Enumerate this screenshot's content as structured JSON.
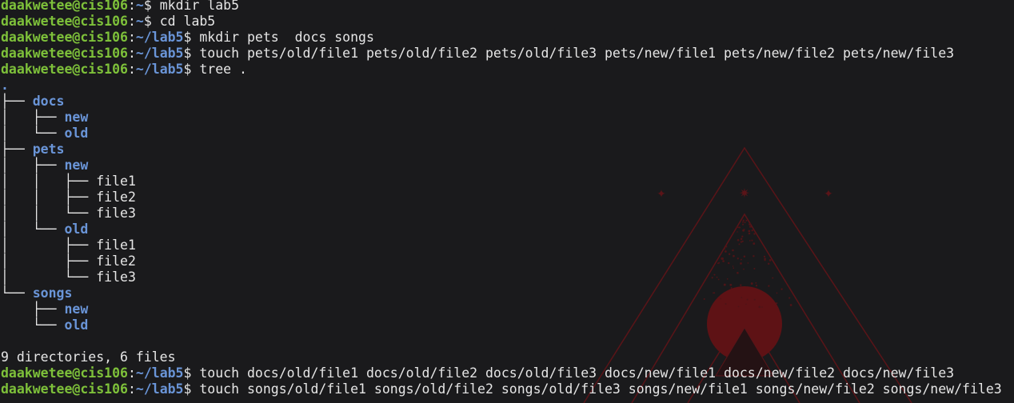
{
  "terminal": {
    "background": "#1a1a1c",
    "colors": {
      "prompt_user": "#7ec13a",
      "prompt_path": "#6a95d8",
      "directory": "#6a95d8",
      "text": "#e6e6e6",
      "wallpaper_accent": "#8b1a1f"
    },
    "prompt_user": "daakwetee@cis106",
    "lines_before_tree": [
      {
        "path": "~",
        "command": "mkdir lab5"
      },
      {
        "path": "~",
        "command": "cd lab5"
      },
      {
        "path": "~/lab5",
        "command": "mkdir pets  docs songs"
      },
      {
        "path": "~/lab5",
        "command": "touch pets/old/file1 pets/old/file2 pets/old/file3 pets/new/file1 pets/new/file2 pets/new/file3"
      },
      {
        "path": "~/lab5",
        "command": "tree ."
      }
    ],
    "tree": [
      {
        "prefix": "",
        "name": ".",
        "kind": "dir"
      },
      {
        "prefix": "├── ",
        "name": "docs",
        "kind": "dir"
      },
      {
        "prefix": "│   ├── ",
        "name": "new",
        "kind": "dir"
      },
      {
        "prefix": "│   └── ",
        "name": "old",
        "kind": "dir"
      },
      {
        "prefix": "├── ",
        "name": "pets",
        "kind": "dir"
      },
      {
        "prefix": "│   ├── ",
        "name": "new",
        "kind": "dir"
      },
      {
        "prefix": "│   │   ├── ",
        "name": "file1",
        "kind": "file"
      },
      {
        "prefix": "│   │   ├── ",
        "name": "file2",
        "kind": "file"
      },
      {
        "prefix": "│   │   └── ",
        "name": "file3",
        "kind": "file"
      },
      {
        "prefix": "│   └── ",
        "name": "old",
        "kind": "dir"
      },
      {
        "prefix": "│       ├── ",
        "name": "file1",
        "kind": "file"
      },
      {
        "prefix": "│       ├── ",
        "name": "file2",
        "kind": "file"
      },
      {
        "prefix": "│       └── ",
        "name": "file3",
        "kind": "file"
      },
      {
        "prefix": "└── ",
        "name": "songs",
        "kind": "dir"
      },
      {
        "prefix": "    ├── ",
        "name": "new",
        "kind": "dir"
      },
      {
        "prefix": "    └── ",
        "name": "old",
        "kind": "dir"
      }
    ],
    "summary": "9 directories, 6 files",
    "lines_after_tree": [
      {
        "path": "~/lab5",
        "command": "touch docs/old/file1 docs/old/file2 docs/old/file3 docs/new/file1 docs/new/file2 docs/new/file3"
      },
      {
        "path": "~/lab5",
        "command": "touch songs/old/file1 songs/old/file2 songs/old/file3 songs/new/file1 songs/new/file2 songs/new/file3"
      }
    ]
  }
}
